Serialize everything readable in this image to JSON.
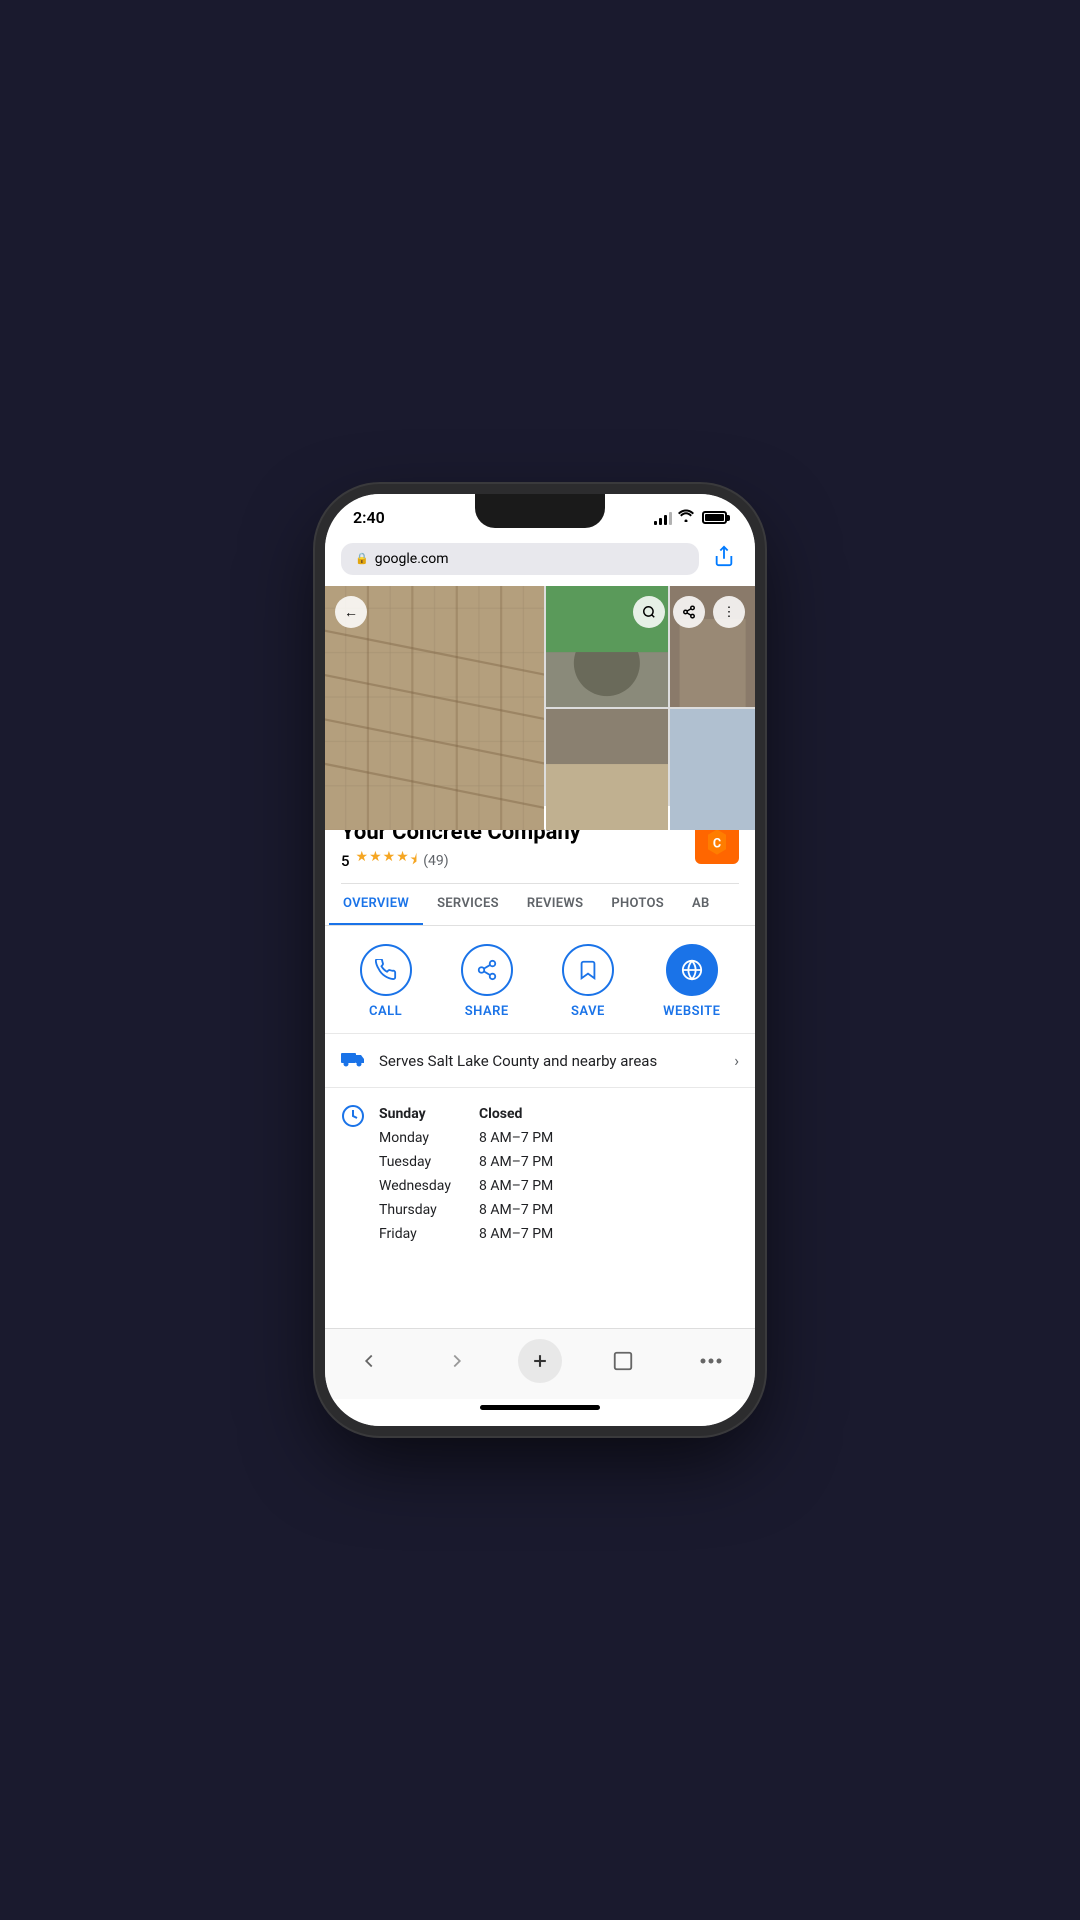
{
  "device": {
    "time": "2:40",
    "url": "google.com"
  },
  "header": {
    "back_icon": "←",
    "search_icon": "🔍",
    "share_grid_icon": "⬆",
    "lock_icon": "🔒",
    "share_browser_icon": "⬆"
  },
  "business": {
    "name": "Your Concrete Company",
    "rating": "5",
    "stars_full": 4,
    "stars_half": 1,
    "review_count": "(49)"
  },
  "tabs": [
    {
      "label": "OVERVIEW",
      "active": true
    },
    {
      "label": "SERVICES",
      "active": false
    },
    {
      "label": "REVIEWS",
      "active": false
    },
    {
      "label": "PHOTOS",
      "active": false
    },
    {
      "label": "AB",
      "active": false
    }
  ],
  "actions": [
    {
      "id": "call",
      "label": "CALL",
      "icon": "📞",
      "filled": false
    },
    {
      "id": "share",
      "label": "SHARE",
      "icon": "⬆",
      "filled": false
    },
    {
      "id": "save",
      "label": "SAVE",
      "icon": "🔖",
      "filled": false
    },
    {
      "id": "website",
      "label": "WEBSITE",
      "icon": "🌐",
      "filled": true
    }
  ],
  "service_area": {
    "icon": "🚚",
    "text": "Serves Salt Lake County and nearby areas",
    "chevron": "›"
  },
  "hours": {
    "icon": "🕐",
    "days": [
      {
        "day": "Sunday",
        "time": "Closed",
        "bold": true
      },
      {
        "day": "Monday",
        "time": "8 AM–7 PM",
        "bold": false
      },
      {
        "day": "Tuesday",
        "time": "8 AM–7 PM",
        "bold": false
      },
      {
        "day": "Wednesday",
        "time": "8 AM–7 PM",
        "bold": false
      },
      {
        "day": "Thursday",
        "time": "8 AM–7 PM",
        "bold": false
      },
      {
        "day": "Friday",
        "time": "8 AM–7 PM",
        "bold": false
      }
    ]
  },
  "bottom_nav": {
    "back": "‹",
    "forward": "›",
    "add": "+",
    "tabs": "⬜",
    "more": "···"
  },
  "colors": {
    "accent": "#1a73e8",
    "star": "#f5a623",
    "text_primary": "#202124",
    "text_secondary": "#5f6368"
  }
}
